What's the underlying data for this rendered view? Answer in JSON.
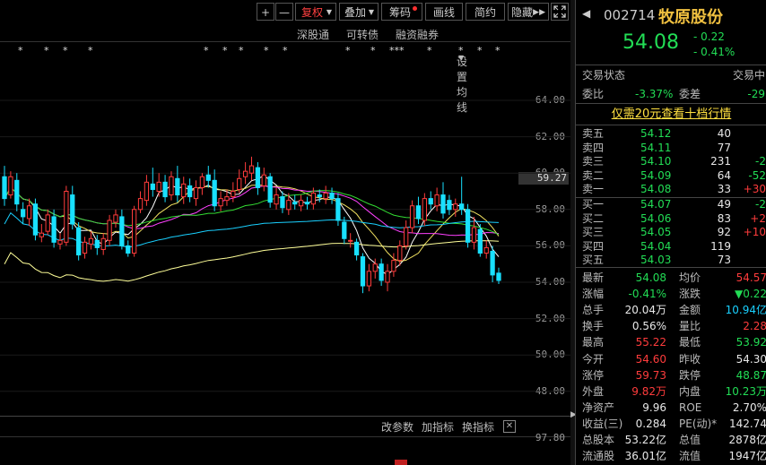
{
  "toolbar": {
    "plus": "+",
    "minus": "—",
    "fuquan": "复权",
    "diejia": "叠加",
    "chouma": "筹码",
    "huaxian": "画线",
    "jianyue": "简约",
    "yincang": "隐藏",
    "fullscreen_icon": "expand-icon"
  },
  "subbar": {
    "shengutong": "深股通",
    "kezhuanzhai": "可转债",
    "rongzi": "融资融券",
    "junxian": "设置均线"
  },
  "chart_data": {
    "type": "candlestick",
    "yticks": [
      "64.00",
      "62.00",
      "60.00",
      "58.00",
      "56.00",
      "54.00",
      "52.00",
      "50.00",
      "48.00"
    ],
    "price_marker": "59.27",
    "indicator_tick": "97.80",
    "candles": [
      {
        "o": 59.8,
        "c": 58.6,
        "h": 60.4,
        "l": 58.2
      },
      {
        "o": 58.8,
        "c": 59.8,
        "h": 60.1,
        "l": 58.6
      },
      {
        "o": 59.6,
        "c": 58.3,
        "h": 60.0,
        "l": 57.9
      },
      {
        "o": 58.0,
        "c": 57.6,
        "h": 58.4,
        "l": 57.2
      },
      {
        "o": 57.5,
        "c": 58.2,
        "h": 58.6,
        "l": 57.1
      },
      {
        "o": 58.3,
        "c": 56.6,
        "h": 58.6,
        "l": 56.3
      },
      {
        "o": 56.5,
        "c": 56.7,
        "h": 57.2,
        "l": 56.2
      },
      {
        "o": 56.8,
        "c": 57.7,
        "h": 58.0,
        "l": 56.6
      },
      {
        "o": 57.6,
        "c": 56.2,
        "h": 58.0,
        "l": 55.9
      },
      {
        "o": 56.1,
        "c": 56.3,
        "h": 56.7,
        "l": 55.8
      },
      {
        "o": 56.2,
        "c": 59.0,
        "h": 59.3,
        "l": 56.0
      },
      {
        "o": 58.8,
        "c": 57.2,
        "h": 59.3,
        "l": 56.9
      },
      {
        "o": 57.0,
        "c": 55.5,
        "h": 57.3,
        "l": 55.2
      },
      {
        "o": 55.6,
        "c": 56.2,
        "h": 56.5,
        "l": 55.3
      },
      {
        "o": 56.1,
        "c": 56.4,
        "h": 56.8,
        "l": 55.8
      },
      {
        "o": 56.3,
        "c": 55.9,
        "h": 56.6,
        "l": 55.5
      },
      {
        "o": 55.8,
        "c": 56.4,
        "h": 56.7,
        "l": 55.5
      },
      {
        "o": 56.3,
        "c": 57.4,
        "h": 57.7,
        "l": 56.0
      },
      {
        "o": 57.3,
        "c": 57.7,
        "h": 58.0,
        "l": 57.0
      },
      {
        "o": 57.6,
        "c": 56.0,
        "h": 58.0,
        "l": 55.8
      },
      {
        "o": 56.0,
        "c": 55.6,
        "h": 56.3,
        "l": 55.4
      },
      {
        "o": 55.6,
        "c": 58.0,
        "h": 58.2,
        "l": 55.4
      },
      {
        "o": 58.0,
        "c": 58.6,
        "h": 59.0,
        "l": 57.8
      },
      {
        "o": 58.5,
        "c": 59.5,
        "h": 59.9,
        "l": 58.2
      },
      {
        "o": 59.4,
        "c": 59.1,
        "h": 60.3,
        "l": 58.7
      },
      {
        "o": 59.0,
        "c": 59.5,
        "h": 60.0,
        "l": 58.7
      },
      {
        "o": 59.5,
        "c": 58.7,
        "h": 59.9,
        "l": 58.4
      },
      {
        "o": 58.8,
        "c": 59.8,
        "h": 60.1,
        "l": 58.5
      },
      {
        "o": 59.7,
        "c": 58.8,
        "h": 60.4,
        "l": 58.4
      },
      {
        "o": 58.7,
        "c": 59.4,
        "h": 59.8,
        "l": 58.3
      },
      {
        "o": 59.3,
        "c": 58.7,
        "h": 59.7,
        "l": 58.4
      },
      {
        "o": 58.6,
        "c": 59.2,
        "h": 59.6,
        "l": 58.2
      },
      {
        "o": 59.2,
        "c": 59.8,
        "h": 60.0,
        "l": 58.8
      },
      {
        "o": 59.9,
        "c": 59.6,
        "h": 60.4,
        "l": 59.2
      },
      {
        "o": 59.6,
        "c": 58.2,
        "h": 60.2,
        "l": 57.9
      },
      {
        "o": 58.2,
        "c": 58.6,
        "h": 59.0,
        "l": 57.9
      },
      {
        "o": 58.5,
        "c": 58.7,
        "h": 59.1,
        "l": 58.2
      },
      {
        "o": 58.7,
        "c": 59.0,
        "h": 59.5,
        "l": 58.4
      },
      {
        "o": 59.1,
        "c": 59.7,
        "h": 60.2,
        "l": 58.9
      },
      {
        "o": 59.8,
        "c": 60.1,
        "h": 60.6,
        "l": 59.4
      },
      {
        "o": 60.0,
        "c": 60.4,
        "h": 60.9,
        "l": 59.6
      },
      {
        "o": 60.3,
        "c": 59.2,
        "h": 60.6,
        "l": 58.8
      },
      {
        "o": 59.3,
        "c": 59.9,
        "h": 60.3,
        "l": 59.0
      },
      {
        "o": 59.8,
        "c": 58.4,
        "h": 60.0,
        "l": 58.1
      },
      {
        "o": 58.3,
        "c": 58.8,
        "h": 59.2,
        "l": 58.0
      },
      {
        "o": 58.7,
        "c": 58.1,
        "h": 59.0,
        "l": 57.8
      },
      {
        "o": 58.0,
        "c": 58.5,
        "h": 58.9,
        "l": 57.7
      },
      {
        "o": 58.4,
        "c": 58.3,
        "h": 58.8,
        "l": 58.0
      },
      {
        "o": 58.2,
        "c": 58.5,
        "h": 58.8,
        "l": 57.9
      },
      {
        "o": 58.4,
        "c": 58.3,
        "h": 58.7,
        "l": 58.0
      },
      {
        "o": 58.3,
        "c": 58.9,
        "h": 59.2,
        "l": 58.0
      },
      {
        "o": 58.8,
        "c": 58.7,
        "h": 59.1,
        "l": 58.4
      },
      {
        "o": 58.6,
        "c": 58.9,
        "h": 59.3,
        "l": 58.3
      },
      {
        "o": 58.9,
        "c": 58.6,
        "h": 59.2,
        "l": 58.3
      },
      {
        "o": 58.6,
        "c": 57.4,
        "h": 58.9,
        "l": 57.1
      },
      {
        "o": 57.3,
        "c": 56.4,
        "h": 57.6,
        "l": 56.1
      },
      {
        "o": 56.3,
        "c": 56.3,
        "h": 56.7,
        "l": 55.9
      },
      {
        "o": 56.2,
        "c": 55.5,
        "h": 56.4,
        "l": 55.2
      },
      {
        "o": 55.4,
        "c": 53.8,
        "h": 55.6,
        "l": 53.4
      },
      {
        "o": 53.8,
        "c": 54.6,
        "h": 55.0,
        "l": 53.5
      },
      {
        "o": 54.6,
        "c": 55.0,
        "h": 55.3,
        "l": 54.2
      },
      {
        "o": 55.0,
        "c": 54.1,
        "h": 55.3,
        "l": 53.8
      },
      {
        "o": 54.0,
        "c": 54.6,
        "h": 55.0,
        "l": 53.5
      },
      {
        "o": 54.6,
        "c": 55.2,
        "h": 55.6,
        "l": 54.3
      },
      {
        "o": 55.2,
        "c": 56.0,
        "h": 56.3,
        "l": 54.9
      },
      {
        "o": 56.0,
        "c": 57.0,
        "h": 57.4,
        "l": 55.8
      },
      {
        "o": 57.0,
        "c": 58.2,
        "h": 58.5,
        "l": 56.7
      },
      {
        "o": 58.2,
        "c": 57.5,
        "h": 58.7,
        "l": 57.2
      },
      {
        "o": 57.4,
        "c": 58.6,
        "h": 58.9,
        "l": 57.1
      },
      {
        "o": 58.6,
        "c": 58.3,
        "h": 59.0,
        "l": 58.0
      },
      {
        "o": 58.2,
        "c": 58.8,
        "h": 59.2,
        "l": 57.9
      },
      {
        "o": 58.8,
        "c": 57.8,
        "h": 59.5,
        "l": 57.5
      },
      {
        "o": 58.5,
        "c": 58.0,
        "h": 58.8,
        "l": 57.7
      },
      {
        "o": 58.0,
        "c": 58.3,
        "h": 58.6,
        "l": 57.6
      },
      {
        "o": 58.3,
        "c": 58.0,
        "h": 59.8,
        "l": 57.7
      },
      {
        "o": 58.0,
        "c": 56.2,
        "h": 58.3,
        "l": 55.9
      },
      {
        "o": 56.2,
        "c": 57.0,
        "h": 57.6,
        "l": 55.8
      },
      {
        "o": 56.9,
        "c": 55.6,
        "h": 57.2,
        "l": 55.4
      },
      {
        "o": 55.6,
        "c": 55.9,
        "h": 56.3,
        "l": 55.3
      },
      {
        "o": 55.7,
        "c": 54.4,
        "h": 56.0,
        "l": 54.0
      },
      {
        "o": 54.5,
        "c": 54.1,
        "h": 54.8,
        "l": 53.9
      }
    ],
    "ma_colors": [
      "#ffffff",
      "#f0e060",
      "#ff40ff",
      "#33dd33",
      "#19d0ff",
      "#ffff99"
    ]
  },
  "stars": [
    "*",
    "*",
    "*",
    "*",
    "*",
    "*",
    "*",
    "*",
    "*",
    "*",
    "*",
    "***",
    "*",
    "*",
    "*",
    "*"
  ],
  "bottombar": {
    "gaicanshu": "改参数",
    "jiazhibiao": "加指标",
    "huanzhibiao": "换指标",
    "close_icon": "close-icon"
  },
  "quote": {
    "code": "002714",
    "name": "牧原股份",
    "price": "54.08",
    "change": "- 0.22",
    "change_pct": "- 0.41%",
    "status_label": "交易状态",
    "status_value": "交易中",
    "weibi_label": "委比",
    "weibi_value": "-3.37%",
    "weicha_label": "委差",
    "weicha_value": "-29",
    "promo": "仅需20元查看十档行情"
  },
  "asks": [
    {
      "label": "卖五",
      "price": "54.12",
      "vol": "40",
      "chg": ""
    },
    {
      "label": "卖四",
      "price": "54.11",
      "vol": "77",
      "chg": ""
    },
    {
      "label": "卖三",
      "price": "54.10",
      "vol": "231",
      "chg": "-2"
    },
    {
      "label": "卖二",
      "price": "54.09",
      "vol": "64",
      "chg": "-52"
    },
    {
      "label": "卖一",
      "price": "54.08",
      "vol": "33",
      "chg": "+30"
    }
  ],
  "bids": [
    {
      "label": "买一",
      "price": "54.07",
      "vol": "49",
      "chg": "-2"
    },
    {
      "label": "买二",
      "price": "54.06",
      "vol": "83",
      "chg": "+2"
    },
    {
      "label": "买三",
      "price": "54.05",
      "vol": "92",
      "chg": "+10"
    },
    {
      "label": "买四",
      "price": "54.04",
      "vol": "119",
      "chg": ""
    },
    {
      "label": "买五",
      "price": "54.03",
      "vol": "73",
      "chg": ""
    }
  ],
  "stats": [
    {
      "l1": "最新",
      "v1": "54.08",
      "c1": "green",
      "l2": "均价",
      "v2": "54.57",
      "c2": "red"
    },
    {
      "l1": "涨幅",
      "v1": "-0.41%",
      "c1": "green",
      "l2": "涨跌",
      "v2": "▼0.22",
      "c2": "green"
    },
    {
      "l1": "总手",
      "v1": "20.04万",
      "c1": "white",
      "l2": "金额",
      "v2": "10.94亿",
      "c2": "cyan"
    },
    {
      "l1": "换手",
      "v1": "0.56%",
      "c1": "white",
      "l2": "量比",
      "v2": "2.28",
      "c2": "red"
    },
    {
      "l1": "最高",
      "v1": "55.22",
      "c1": "red",
      "l2": "最低",
      "v2": "53.92",
      "c2": "green"
    },
    {
      "l1": "今开",
      "v1": "54.60",
      "c1": "red",
      "l2": "昨收",
      "v2": "54.30",
      "c2": "white"
    },
    {
      "l1": "涨停",
      "v1": "59.73",
      "c1": "red",
      "l2": "跌停",
      "v2": "48.87",
      "c2": "green"
    },
    {
      "l1": "外盘",
      "v1": "9.82万",
      "c1": "red",
      "l2": "内盘",
      "v2": "10.23万",
      "c2": "green"
    },
    {
      "l1": "净资产",
      "v1": "9.96",
      "c1": "white",
      "l2": "ROE",
      "v2": "2.70%",
      "c2": "white"
    },
    {
      "l1": "收益(三)",
      "v1": "0.284",
      "c1": "white",
      "l2": "PE(动)*",
      "v2": "142.74",
      "c2": "white"
    },
    {
      "l1": "总股本",
      "v1": "53.22亿",
      "c1": "white",
      "l2": "总值",
      "v2": "2878亿",
      "c2": "white"
    },
    {
      "l1": "流通股",
      "v1": "36.01亿",
      "c1": "white",
      "l2": "流值",
      "v2": "1947亿",
      "c2": "white"
    }
  ]
}
